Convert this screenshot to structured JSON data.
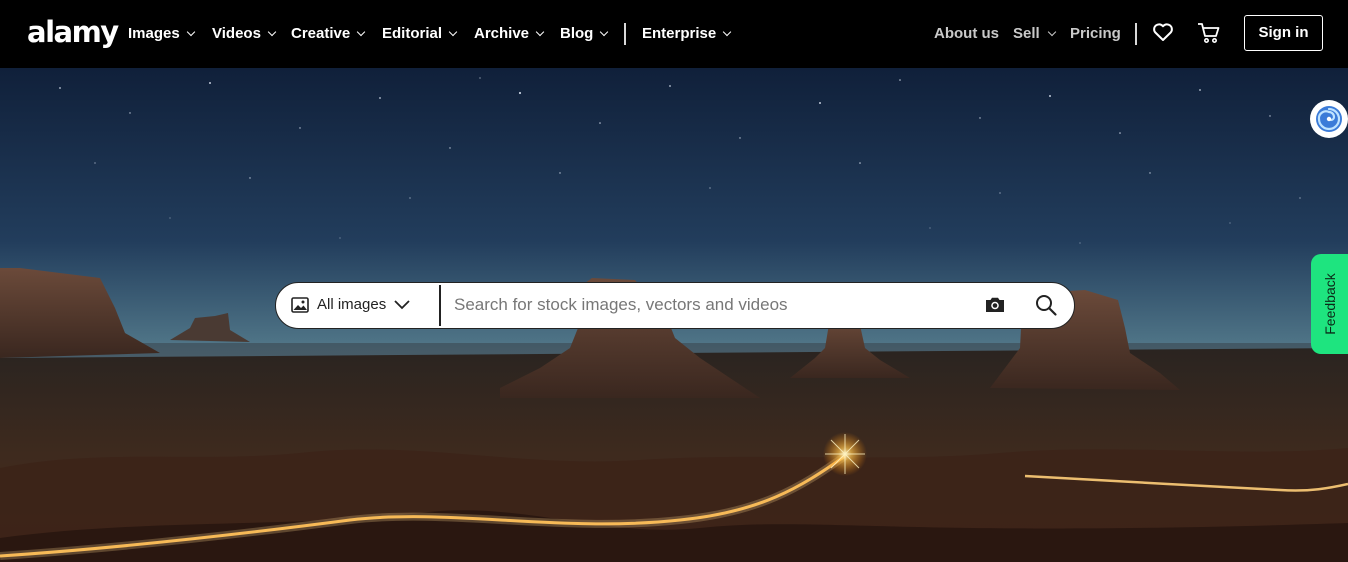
{
  "brand": {
    "logo_text": "alamy"
  },
  "nav": {
    "left": [
      {
        "label": "Images"
      },
      {
        "label": "Videos"
      },
      {
        "label": "Creative"
      },
      {
        "label": "Editorial"
      },
      {
        "label": "Archive"
      },
      {
        "label": "Blog"
      },
      {
        "label": "Enterprise"
      }
    ],
    "right": {
      "about": "About us",
      "sell": "Sell",
      "pricing": "Pricing"
    },
    "icons": {
      "favorites": "heart-icon",
      "cart": "cart-icon"
    },
    "sign_in": "Sign in"
  },
  "search": {
    "scope_label": "All images",
    "scope_icon": "image-icon",
    "placeholder": "Search for stock images, vectors and videos",
    "camera_icon": "camera-icon",
    "submit_icon": "search-icon"
  },
  "side": {
    "feedback_label": "Feedback",
    "feedback_color": "#1ee47f",
    "assistant_icon": "spiral-assistant-icon"
  },
  "colors": {
    "nav_bg": "#000000",
    "text": "#ffffff",
    "muted_nav": "#c9c9c9"
  }
}
